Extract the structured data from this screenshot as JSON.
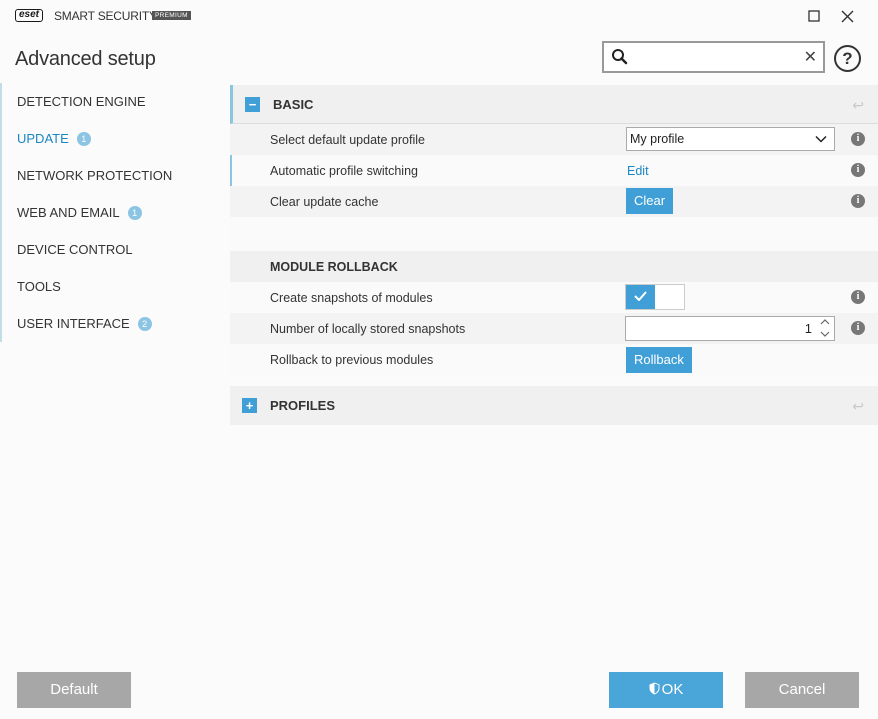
{
  "app": {
    "logo_text": "eset",
    "product_name": "SMART SECURITY",
    "edition_badge": "PREMIUM",
    "page_title": "Advanced setup"
  },
  "window": {
    "maximize_glyph": "☐",
    "close_glyph": "✕"
  },
  "search": {
    "placeholder": "",
    "value": "",
    "clear_glyph": "✕"
  },
  "help_glyph": "?",
  "sidebar": {
    "items": [
      {
        "label": "DETECTION ENGINE",
        "badge": ""
      },
      {
        "label": "UPDATE",
        "badge": "1"
      },
      {
        "label": "NETWORK PROTECTION",
        "badge": ""
      },
      {
        "label": "WEB AND EMAIL",
        "badge": "1"
      },
      {
        "label": "DEVICE CONTROL",
        "badge": ""
      },
      {
        "label": "TOOLS",
        "badge": ""
      },
      {
        "label": "USER INTERFACE",
        "badge": "2"
      }
    ]
  },
  "basic": {
    "title": "BASIC",
    "collapse_glyph": "−",
    "select_profile_label": "Select default update profile",
    "select_profile_value": "My profile",
    "auto_switch_label": "Automatic profile switching",
    "auto_switch_link": "Edit",
    "clear_cache_label": "Clear update cache",
    "clear_button": "Clear"
  },
  "rollback": {
    "title": "MODULE ROLLBACK",
    "snapshots_label": "Create snapshots of modules",
    "snapshots_enabled": true,
    "count_label": "Number of locally stored snapshots",
    "count_value": "1",
    "rollback_label": "Rollback to previous modules",
    "rollback_button": "Rollback"
  },
  "profiles": {
    "title": "PROFILES",
    "expand_glyph": "+"
  },
  "info_glyph": "i",
  "reset_glyph": "↩",
  "footer": {
    "default_label": "Default",
    "ok_label": "OK",
    "cancel_label": "Cancel"
  },
  "colors": {
    "accent": "#3f9fd6",
    "link": "#1b86c4",
    "gray_button": "#a7a7a7"
  }
}
